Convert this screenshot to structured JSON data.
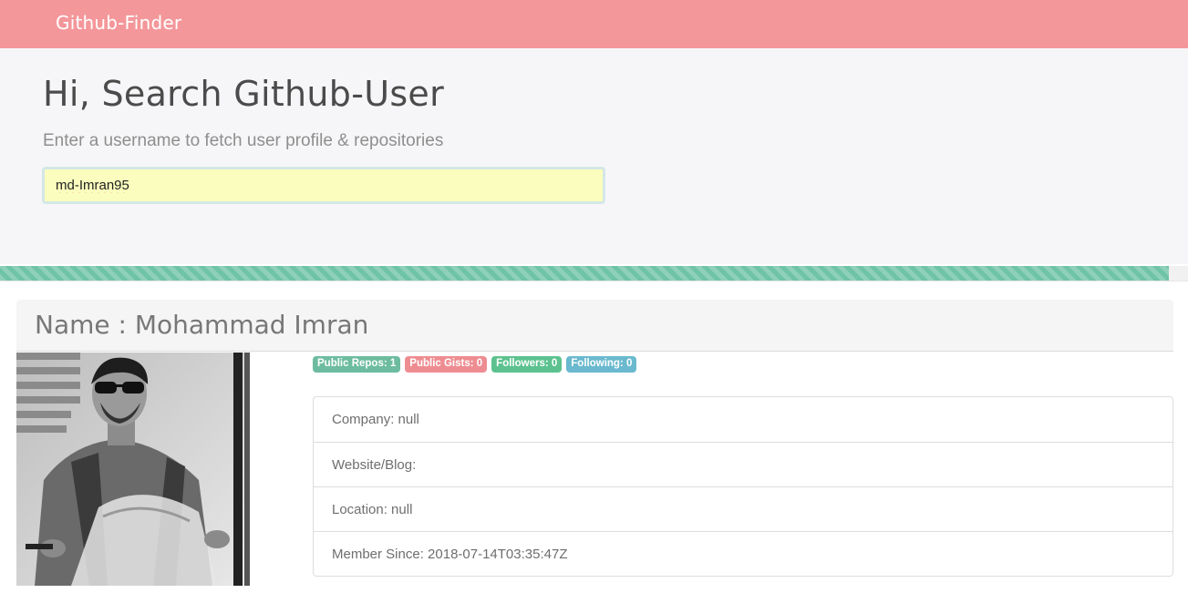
{
  "navbar": {
    "brand": "Github-Finder"
  },
  "search": {
    "title": "Hi, Search Github-User",
    "subtitle": "Enter a username to fetch user profile & repositories",
    "value": "md-Imran95"
  },
  "progress": {
    "fraction": 0.984,
    "color": "#6fc3a6"
  },
  "profile": {
    "name_prefix": "Name : ",
    "name": "Mohammad Imran",
    "avatar_icon": "user-photo",
    "badges": [
      {
        "label": "Public Repos: 1",
        "color": "#6dbca0"
      },
      {
        "label": "Public Gists: 0",
        "color": "#ee8d91"
      },
      {
        "label": "Followers: 0",
        "color": "#5cc28f"
      },
      {
        "label": "Following: 0",
        "color": "#6ab9cf"
      }
    ],
    "details": [
      "Company: null",
      "Website/Blog:",
      "Location: null",
      "Member Since: 2018-07-14T03:35:47Z"
    ]
  },
  "colors": {
    "navbar": "#f4979a",
    "jumbotron": "#f6f6f8",
    "input_bg": "#fafdbd"
  }
}
